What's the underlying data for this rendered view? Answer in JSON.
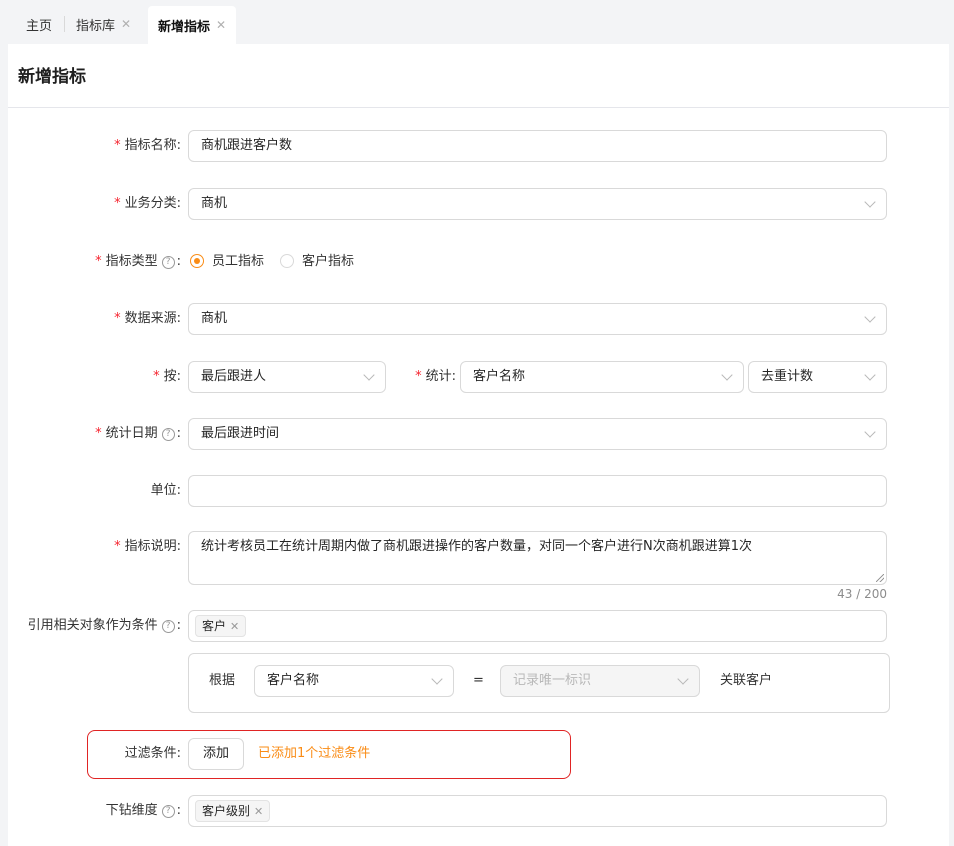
{
  "tabs": [
    {
      "label": "主页",
      "closable": false,
      "active": false
    },
    {
      "label": "指标库",
      "closable": true,
      "active": false
    },
    {
      "label": "新增指标",
      "closable": true,
      "active": true
    }
  ],
  "page": {
    "title": "新增指标"
  },
  "form": {
    "name": {
      "label": "指标名称:",
      "value": "商机跟进客户数"
    },
    "category": {
      "label": "业务分类:",
      "value": "商机"
    },
    "type": {
      "label": "指标类型",
      "help": "?",
      "colon": ":",
      "options": [
        "员工指标",
        "客户指标"
      ],
      "selected": "员工指标"
    },
    "source": {
      "label": "数据来源:",
      "value": "商机"
    },
    "by": {
      "label": "按:",
      "value": "最后跟进人"
    },
    "stat": {
      "label": "统计:",
      "field": "客户名称",
      "method": "去重计数"
    },
    "date": {
      "label": "统计日期",
      "help": "?",
      "colon": ":",
      "value": "最后跟进时间"
    },
    "unit": {
      "label": "单位:",
      "value": ""
    },
    "desc": {
      "label": "指标说明:",
      "value": "统计考核员工在统计周期内做了商机跟进操作的客户数量，对同一个客户进行N次商机跟进算1次",
      "counter": "43 / 200"
    },
    "related": {
      "label": "引用相关对象作为条件",
      "help": "?",
      "colon": ":",
      "tag": "客户",
      "rule": {
        "prefix": "根据",
        "field": "客户名称",
        "operator": "=",
        "target_placeholder": "记录唯一标识",
        "suffix": "关联客户"
      }
    },
    "filter": {
      "label": "过滤条件:",
      "button": "添加",
      "status": "已添加1个过滤条件"
    },
    "drill": {
      "label": "下钻维度",
      "help": "?",
      "colon": ":",
      "tag": "客户级别"
    }
  },
  "colors": {
    "accent": "#fa8c16",
    "required": "#f5222d",
    "highlight": "#e02424"
  },
  "icons": {
    "close": "close-icon",
    "chevron": "chevron-down-icon",
    "help": "question-circle-icon"
  }
}
